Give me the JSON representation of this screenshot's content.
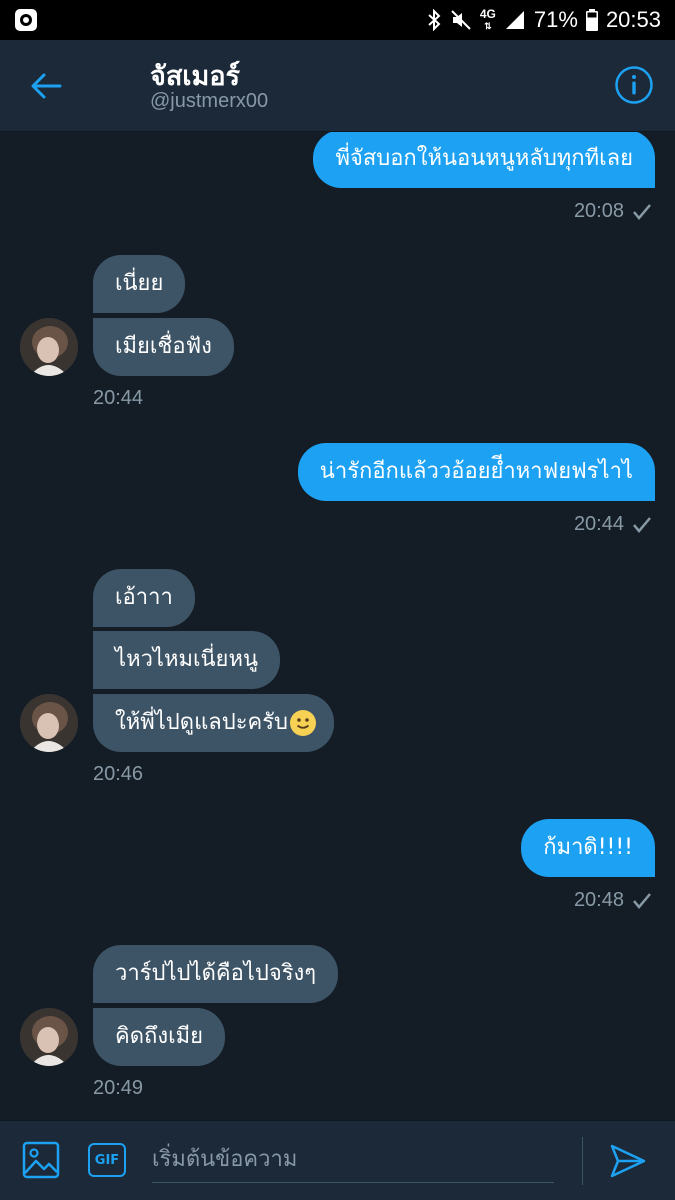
{
  "status_bar": {
    "battery": "71%",
    "time": "20:53",
    "network": "4G"
  },
  "header": {
    "name": "จัสเมอร์",
    "handle": "@justmerx00"
  },
  "messages": {
    "m1": {
      "text": "พี่จัสบอกให้นอนหนูหลับทุกทีเลย",
      "time": "20:08"
    },
    "m2": {
      "text": "เนี่ยย"
    },
    "m3": {
      "text": "เมียเชื่อฟัง",
      "time": "20:44"
    },
    "m4": {
      "text": "น่ารักอีกแล้ววอ้อยยีำหาฟยฟรไาไ",
      "time": "20:44"
    },
    "m5": {
      "text": "เอ้าาา"
    },
    "m6": {
      "text": "ไหวไหมเนี่ยหนู"
    },
    "m7": {
      "text": "ให้พี่ไปดูแลปะครับ",
      "time": "20:46"
    },
    "m8": {
      "text": "ก้มาดิ!!!!",
      "time": "20:48"
    },
    "m9": {
      "text": "วาร์ปไปได้คือไปจริงๆ"
    },
    "m10": {
      "text": "คิดถึงเมีย",
      "time": "20:49"
    }
  },
  "composer": {
    "placeholder": "เริ่มต้นข้อความ",
    "gif_label": "GIF"
  },
  "colors": {
    "accent": "#1da1f2",
    "background": "#141d26",
    "incoming_bubble": "#3d5466",
    "header_bg": "#1c2938"
  }
}
